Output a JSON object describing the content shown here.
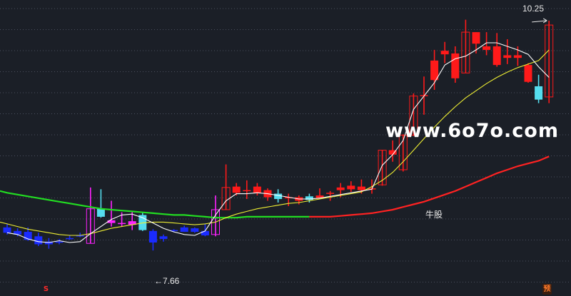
{
  "chart_data": {
    "type": "candlestick",
    "ylim": [
      7.3,
      10.45
    ],
    "grid": true,
    "colors": {
      "background": "#1b1f27",
      "grid": "#4a4f5e",
      "up": "#ff1a1a",
      "down": "#ff1a1a",
      "up_early": "#ff22ff",
      "down_early": "#1a2bff",
      "down_cyan": "#55ddee",
      "ma5": "#ffffff",
      "ma10": "#eeee33",
      "ma_long": "#ff2222",
      "ma_long_early": "#22dd22"
    },
    "candles": [
      {
        "o": 7.92,
        "c": 7.86,
        "h": 7.96,
        "l": 7.84,
        "kind": "down"
      },
      {
        "o": 7.88,
        "c": 7.84,
        "h": 7.91,
        "l": 7.82,
        "kind": "down"
      },
      {
        "o": 7.87,
        "c": 7.78,
        "h": 7.92,
        "l": 7.77,
        "kind": "down"
      },
      {
        "o": 7.82,
        "c": 7.73,
        "h": 7.86,
        "l": 7.71,
        "kind": "down"
      },
      {
        "o": 7.76,
        "c": 7.73,
        "h": 7.8,
        "l": 7.68,
        "kind": "down"
      },
      {
        "o": 7.76,
        "c": 7.76,
        "h": 7.79,
        "l": 7.73,
        "kind": "down"
      },
      {
        "o": 7.8,
        "c": 7.8,
        "h": 7.83,
        "l": 7.78,
        "kind": "down"
      },
      {
        "o": 7.83,
        "c": 7.83,
        "h": 7.86,
        "l": 7.81,
        "kind": "down"
      },
      {
        "o": 7.74,
        "c": 8.13,
        "h": 8.37,
        "l": 7.74,
        "kind": "up_early"
      },
      {
        "o": 8.13,
        "c": 8.04,
        "h": 8.35,
        "l": 8.03,
        "kind": "down_cyan"
      },
      {
        "o": 8.0,
        "c": 7.97,
        "h": 8.22,
        "l": 7.93,
        "kind": "up_early"
      },
      {
        "o": 7.97,
        "c": 7.96,
        "h": 8.09,
        "l": 7.93,
        "kind": "up_early"
      },
      {
        "o": 7.99,
        "c": 7.95,
        "h": 8.1,
        "l": 7.89,
        "kind": "up_early"
      },
      {
        "o": 8.06,
        "c": 7.89,
        "h": 8.09,
        "l": 7.88,
        "kind": "down_cyan"
      },
      {
        "o": 7.88,
        "c": 7.75,
        "h": 7.9,
        "l": 7.66,
        "kind": "down"
      },
      {
        "o": 7.82,
        "c": 7.79,
        "h": 7.84,
        "l": 7.76,
        "kind": "down"
      },
      {
        "o": 7.89,
        "c": 7.89,
        "h": 7.9,
        "l": 7.87,
        "kind": "down"
      },
      {
        "o": 7.92,
        "c": 7.87,
        "h": 7.94,
        "l": 7.87,
        "kind": "down"
      },
      {
        "o": 7.91,
        "c": 7.87,
        "h": 7.92,
        "l": 7.86,
        "kind": "down"
      },
      {
        "o": 7.88,
        "c": 7.83,
        "h": 7.96,
        "l": 7.82,
        "kind": "down"
      },
      {
        "o": 7.84,
        "c": 8.12,
        "h": 8.28,
        "l": 7.82,
        "kind": "up_early"
      },
      {
        "o": 8.12,
        "c": 8.37,
        "h": 8.63,
        "l": 8.12,
        "kind": "up"
      },
      {
        "o": 8.38,
        "c": 8.31,
        "h": 8.42,
        "l": 8.28,
        "kind": "down"
      },
      {
        "o": 8.34,
        "c": 8.34,
        "h": 8.45,
        "l": 8.24,
        "kind": "down"
      },
      {
        "o": 8.38,
        "c": 8.31,
        "h": 8.42,
        "l": 8.28,
        "kind": "down"
      },
      {
        "o": 8.34,
        "c": 8.26,
        "h": 8.36,
        "l": 8.22,
        "kind": "down"
      },
      {
        "o": 8.3,
        "c": 8.24,
        "h": 8.35,
        "l": 8.2,
        "kind": "down_cyan"
      },
      {
        "o": 8.26,
        "c": 8.26,
        "h": 8.3,
        "l": 8.16,
        "kind": "down"
      },
      {
        "o": 8.26,
        "c": 8.22,
        "h": 8.28,
        "l": 8.18,
        "kind": "down"
      },
      {
        "o": 8.27,
        "c": 8.23,
        "h": 8.3,
        "l": 8.2,
        "kind": "down_cyan"
      },
      {
        "o": 8.28,
        "c": 8.25,
        "h": 8.36,
        "l": 8.25,
        "kind": "down"
      },
      {
        "o": 8.31,
        "c": 8.31,
        "h": 8.33,
        "l": 8.22,
        "kind": "down"
      },
      {
        "o": 8.37,
        "c": 8.34,
        "h": 8.42,
        "l": 8.26,
        "kind": "down"
      },
      {
        "o": 8.39,
        "c": 8.35,
        "h": 8.44,
        "l": 8.32,
        "kind": "down"
      },
      {
        "o": 8.38,
        "c": 8.34,
        "h": 8.46,
        "l": 8.3,
        "kind": "down"
      },
      {
        "o": 8.36,
        "c": 8.36,
        "h": 8.46,
        "l": 8.3,
        "kind": "down"
      },
      {
        "o": 8.4,
        "c": 8.79,
        "h": 8.79,
        "l": 8.39,
        "kind": "up"
      },
      {
        "o": 8.79,
        "c": 8.74,
        "h": 8.9,
        "l": 8.66,
        "kind": "down"
      },
      {
        "o": 8.57,
        "c": 8.96,
        "h": 8.97,
        "l": 8.55,
        "kind": "up"
      },
      {
        "o": 8.96,
        "c": 9.4,
        "h": 9.43,
        "l": 8.95,
        "kind": "up"
      },
      {
        "o": 9.4,
        "c": 9.41,
        "h": 9.62,
        "l": 9.19,
        "kind": "down"
      },
      {
        "o": 9.58,
        "c": 9.8,
        "h": 9.92,
        "l": 9.47,
        "kind": "down"
      },
      {
        "o": 9.91,
        "c": 9.87,
        "h": 10.01,
        "l": 9.77,
        "kind": "down"
      },
      {
        "o": 9.88,
        "c": 9.6,
        "h": 9.96,
        "l": 9.55,
        "kind": "down"
      },
      {
        "o": 9.66,
        "c": 10.12,
        "h": 10.26,
        "l": 9.66,
        "kind": "up"
      },
      {
        "o": 10.12,
        "c": 9.99,
        "h": 10.12,
        "l": 9.88,
        "kind": "down"
      },
      {
        "o": 9.96,
        "c": 9.92,
        "h": 10.12,
        "l": 9.86,
        "kind": "down"
      },
      {
        "o": 9.96,
        "c": 9.75,
        "h": 10.11,
        "l": 9.73,
        "kind": "down"
      },
      {
        "o": 9.86,
        "c": 9.83,
        "h": 10.04,
        "l": 9.76,
        "kind": "down"
      },
      {
        "o": 9.86,
        "c": 9.83,
        "h": 9.96,
        "l": 9.74,
        "kind": "down"
      },
      {
        "o": 9.75,
        "c": 9.56,
        "h": 9.77,
        "l": 9.55,
        "kind": "down"
      },
      {
        "o": 9.51,
        "c": 9.36,
        "h": 9.64,
        "l": 9.32,
        "kind": "down_cyan"
      },
      {
        "o": 9.39,
        "c": 10.2,
        "h": 10.25,
        "l": 9.32,
        "kind": "up"
      }
    ],
    "ma5": [
      7.86,
      7.84,
      7.79,
      7.76,
      7.75,
      7.77,
      7.75,
      7.76,
      7.85,
      7.93,
      8.01,
      8.06,
      8.07,
      8.03,
      7.97,
      7.91,
      7.87,
      7.84,
      7.83,
      7.88,
      8.06,
      8.22,
      8.3,
      8.3,
      8.31,
      8.3,
      8.28,
      8.26,
      8.24,
      8.24,
      8.25,
      8.27,
      8.29,
      8.31,
      8.33,
      8.35,
      8.62,
      8.74,
      8.9,
      9.25,
      9.4,
      9.55,
      9.75,
      9.82,
      9.85,
      9.92,
      10.0,
      10.0,
      9.96,
      9.92,
      9.87,
      9.73,
      9.61
    ],
    "ma10": [
      7.96,
      7.93,
      7.9,
      7.88,
      7.86,
      7.84,
      7.83,
      7.83,
      7.85,
      7.88,
      7.91,
      7.93,
      7.95,
      7.97,
      7.98,
      7.98,
      7.97,
      7.96,
      7.95,
      7.96,
      7.98,
      8.03,
      8.07,
      8.1,
      8.13,
      8.15,
      8.17,
      8.19,
      8.2,
      8.22,
      8.24,
      8.26,
      8.28,
      8.3,
      8.32,
      8.38,
      8.45,
      8.54,
      8.66,
      8.79,
      8.92,
      9.05,
      9.17,
      9.28,
      9.38,
      9.46,
      9.54,
      9.61,
      9.67,
      9.72,
      9.76,
      9.8,
      9.92
    ],
    "ma_long": [
      8.31,
      8.29,
      8.27,
      8.25,
      8.23,
      8.21,
      8.19,
      8.17,
      8.15,
      8.13,
      8.12,
      8.11,
      8.1,
      8.09,
      8.08,
      8.07,
      8.06,
      8.06,
      8.05,
      8.04,
      8.03,
      8.03,
      8.03,
      8.04,
      8.04,
      8.04,
      8.04,
      8.04,
      8.04,
      8.04,
      8.04,
      8.04,
      8.05,
      8.06,
      8.07,
      8.08,
      8.1,
      8.12,
      8.15,
      8.18,
      8.21,
      8.25,
      8.29,
      8.33,
      8.38,
      8.43,
      8.48,
      8.53,
      8.57,
      8.61,
      8.64,
      8.67,
      8.72
    ],
    "ma_long_green_until": 29,
    "high_marker": {
      "text": "10.25",
      "index": 52,
      "price": 10.25
    },
    "low_marker": {
      "text": "←7.66",
      "index": 14,
      "price": 7.66
    }
  },
  "watermark": "www.6o7o.com",
  "overlay_label": "牛股",
  "badges": {
    "s": "S",
    "y": "预"
  }
}
